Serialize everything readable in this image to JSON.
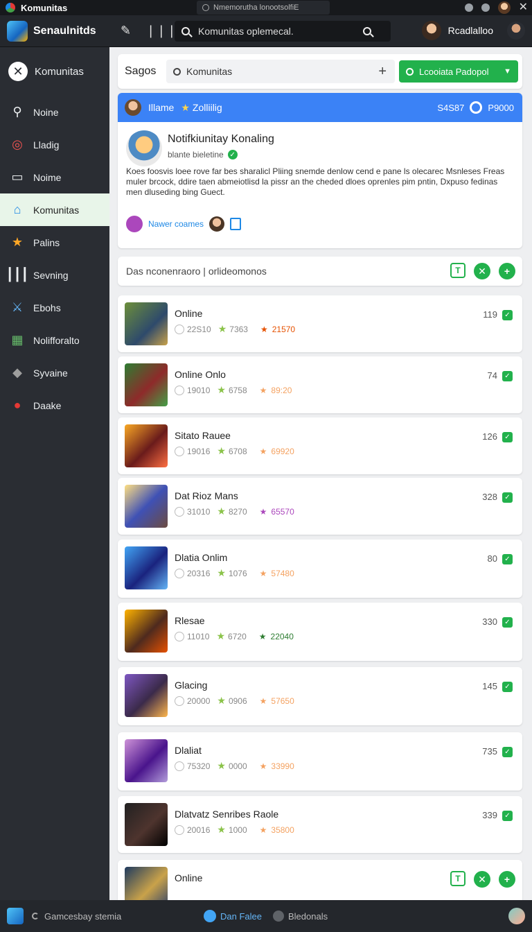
{
  "titlebar": {
    "app_name": "Komunitas",
    "center_text": "Nmemorutha lonootsolfiE"
  },
  "topbar": {
    "brand": "Senaulnitds",
    "search_placeholder": "Komunitas oplemecal.",
    "user_name": "Rcadlalloo"
  },
  "sidebar": {
    "items": [
      {
        "label": "Komunitas",
        "icon": "close-circle-icon"
      },
      {
        "label": "Noine",
        "icon": "search-icon"
      },
      {
        "label": "Lladig",
        "icon": "target-icon"
      },
      {
        "label": "Noime",
        "icon": "window-icon"
      },
      {
        "label": "Komunitas",
        "icon": "community-icon"
      },
      {
        "label": "Palins",
        "icon": "star-icon"
      },
      {
        "label": "Sevning",
        "icon": "bars-icon"
      },
      {
        "label": "Ebohs",
        "icon": "sword-icon"
      },
      {
        "label": "Nolifforalto",
        "icon": "landscape-icon"
      },
      {
        "label": "Syvaine",
        "icon": "shape-icon"
      },
      {
        "label": "Daake",
        "icon": "orb-icon"
      }
    ]
  },
  "search_card": {
    "label": "Sagos",
    "input_value": "Komunitas",
    "button_label": "Lcooiata Padopol"
  },
  "feature": {
    "header_left_a": "Illame",
    "header_left_b": "Zolliilig",
    "header_num": "S4S87",
    "header_right": "P9000",
    "title": "Notifkiunitay Konaling",
    "subtitle": "blante bieletine",
    "description": "Koes foosvis loee rove far bes sharalicl Pliing snemde denlow cend e pane ls olecarec Msnleses Freas muler brcock, ddire taen abmeiotlisd la pissr an the cheded dloes oprenles pim pntin, Dxpuso fedinas men dluseding bing Guect.",
    "footer_link": "Nawer coames"
  },
  "filter_bar": {
    "text": "Das nconenraoro | orlideomonos"
  },
  "games": [
    {
      "title": "Online",
      "m1": "22S10",
      "m2": "7363",
      "m3": "21570",
      "count": "119",
      "m3_color": "#e65100",
      "thumb": "linear-gradient(135deg,#6d8f3a,#2e4a6b 60%,#c9a24a)"
    },
    {
      "title": "Online Onlo",
      "m1": "19010",
      "m2": "6758",
      "m3": "89:20",
      "count": "74",
      "m3_color": "#f4a261",
      "thumb": "linear-gradient(135deg,#2e7d32,#8e2a2a 55%,#43a047)"
    },
    {
      "title": "Sitato Rauee",
      "m1": "19016",
      "m2": "6708",
      "m3": "69920",
      "count": "126",
      "m3_color": "#f4a261",
      "thumb": "linear-gradient(135deg,#f9a825,#6a1b1b 55%,#ff7043)"
    },
    {
      "title": "Dat Rioz Mans",
      "m1": "31010",
      "m2": "8270",
      "m3": "65570",
      "count": "328",
      "m3_color": "#ab47bc",
      "thumb": "linear-gradient(135deg,#ffe082,#3f51b5 50%,#6d4c41)"
    },
    {
      "title": "Dlatia Onlim",
      "m1": "20316",
      "m2": "1076",
      "m3": "57480",
      "count": "80",
      "m3_color": "#f4a261",
      "thumb": "linear-gradient(135deg,#42a5f5,#1a237e 55%,#64b5f6)"
    },
    {
      "title": "Rlesae",
      "m1": "11010",
      "m2": "6720",
      "m3": "22040",
      "count": "330",
      "m3_color": "#2e7d32",
      "thumb": "linear-gradient(135deg,#ffb300,#4e2a1e 55%,#e65100)"
    },
    {
      "title": "Glacing",
      "m1": "20000",
      "m2": "0906",
      "m3": "57650",
      "count": "145",
      "m3_color": "#f4a261",
      "thumb": "linear-gradient(135deg,#7e57c2,#3b2a4a 55%,#ffb74d)"
    },
    {
      "title": "Dlaliat",
      "m1": "75320",
      "m2": "0000",
      "m3": "33990",
      "count": "735",
      "m3_color": "#f4a261",
      "thumb": "linear-gradient(135deg,#ce93d8,#4a148c 55%,#b39ddb)"
    },
    {
      "title": "Dlatvatz Senribes Raole",
      "m1": "20016",
      "m2": "1000",
      "m3": "35800",
      "count": "339",
      "m3_color": "#f4a261",
      "thumb": "linear-gradient(135deg,#212121,#4e342e 55%,#000000)"
    },
    {
      "title": "Online",
      "m1": "",
      "m2": "",
      "m3": "",
      "count": "",
      "m3_color": "#f4a261",
      "thumb": "linear-gradient(135deg,#1e3a5f,#c9a24a 55%,#2b3f6b)"
    }
  ],
  "bottombar": {
    "left_text": "Gamcesbay stemia",
    "tab_active": "Dan Falee",
    "tab_other": "Bledonals"
  },
  "colors": {
    "accent_green": "#22b14c",
    "header_blue": "#3b82f6",
    "sidebar_bg": "#2a2d33",
    "active_item": "#e8f5e9"
  }
}
